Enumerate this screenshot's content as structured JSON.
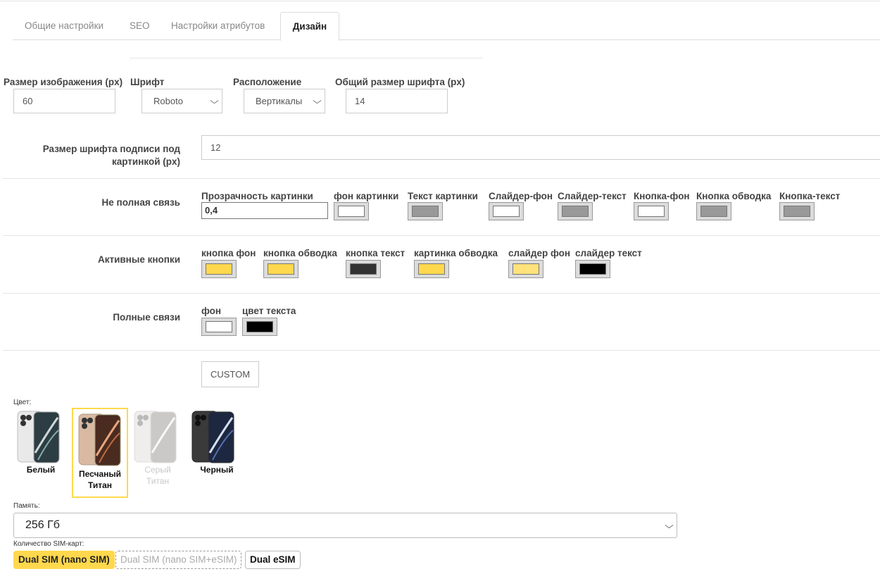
{
  "tabs": [
    {
      "label": "Общие настройки"
    },
    {
      "label": "SEO"
    },
    {
      "label": "Настройки атрибутов"
    },
    {
      "label": "Дизайн"
    }
  ],
  "top_fields": {
    "image_size": {
      "label": "Размер изображения (px)",
      "value": "60"
    },
    "font": {
      "label": "Шрифт",
      "value": "Roboto"
    },
    "layout": {
      "label": "Расположение",
      "value": "Вертикалы"
    },
    "font_size": {
      "label": "Общий размер шрифта (px)",
      "value": "14"
    }
  },
  "caption_font": {
    "label": "Размер шрифта подписи под картинкой (px)",
    "value": "12"
  },
  "partial": {
    "label": "Не полная связь",
    "opacity": {
      "label": "Прозрачность картинки",
      "value": "0,4"
    },
    "colors": [
      {
        "label": "фон картинки",
        "color": "#ffffff"
      },
      {
        "label": "Текст картинки",
        "color": "#999999"
      },
      {
        "label": "Слайдер-фон",
        "color": "#ffffff"
      },
      {
        "label": "Слайдер-текст",
        "color": "#999999"
      },
      {
        "label": "Кнопка-фон",
        "color": "#ffffff"
      },
      {
        "label": "Кнопка обводка",
        "color": "#999999"
      },
      {
        "label": "Кнопка-текст",
        "color": "#999999"
      }
    ]
  },
  "active": {
    "label": "Активные кнопки",
    "colors": [
      {
        "label": "кнопка фон",
        "color": "#ffd84d"
      },
      {
        "label": "кнопка обводка",
        "color": "#ffd84d"
      },
      {
        "label": "кнопка текст",
        "color": "#333333"
      },
      {
        "label": "картинка обводка",
        "color": "#ffd84d"
      },
      {
        "label": "слайдер фон",
        "color": "#ffe27a"
      },
      {
        "label": "слайдер текст",
        "color": "#000000"
      }
    ]
  },
  "full": {
    "label": "Полные связи",
    "colors": [
      {
        "label": "фон",
        "color": "#ffffff"
      },
      {
        "label": "цвет текста",
        "color": "#000000"
      }
    ]
  },
  "custom_button": "CUSTOM",
  "preview": {
    "color_label": "Цвет:",
    "colors": [
      {
        "name": "Белый"
      },
      {
        "name": "Песчаный Титан"
      },
      {
        "name": "Серый Титан"
      },
      {
        "name": "Черный"
      }
    ],
    "memory_label": "Память:",
    "memory_value": "256 Гб",
    "sim_label": "Количество SIM-карт:",
    "sim_options": [
      "Dual SIM (nano SIM)",
      "Dual SIM (nano SIM+eSIM)",
      "Dual eSIM"
    ]
  }
}
